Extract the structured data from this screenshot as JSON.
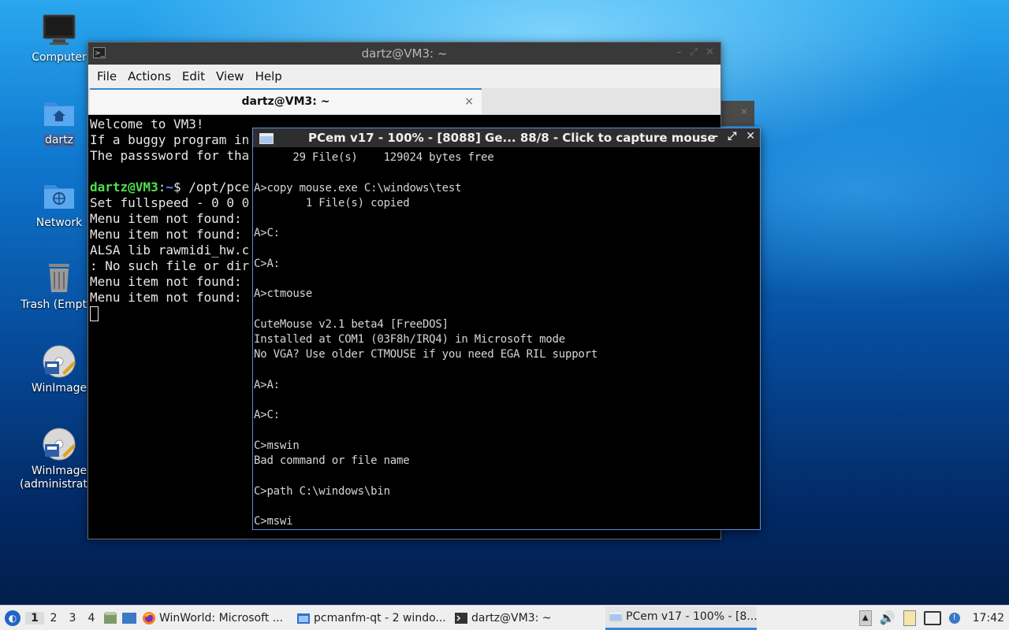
{
  "desktop": {
    "icons": [
      {
        "label": "Computer",
        "icon": "computer-icon"
      },
      {
        "label": "dartz",
        "icon": "home-folder-icon"
      },
      {
        "label": "Network",
        "icon": "network-folder-icon"
      },
      {
        "label": "Trash (Empty)",
        "icon": "trash-icon"
      },
      {
        "label": "WinImage",
        "icon": "winimage-icon"
      },
      {
        "label": "WinImage (administrator)",
        "icon": "winimage-admin-icon"
      }
    ]
  },
  "terminal": {
    "window_title": "dartz@VM3: ~",
    "menu": [
      "File",
      "Actions",
      "Edit",
      "View",
      "Help"
    ],
    "tab_label": "dartz@VM3: ~",
    "tab_close": "×",
    "lines": [
      "Welcome to VM3!",
      "If a buggy program in",
      "The passsword for tha",
      ""
    ],
    "prompt_user": "dartz@VM3",
    "prompt_sep": ":",
    "prompt_path": "~",
    "prompt_cmd": "$ /opt/pce",
    "output_lines": [
      "Set fullspeed - 0 0 0",
      "Menu item not found:",
      "Menu item not found:",
      "ALSA lib rawmidi_hw.c",
      ": No such file or dir",
      "Menu item not found:",
      "Menu item not found:"
    ]
  },
  "pcem": {
    "window_title": "PCem v17 - 100% - [8088] Ge... 88/8 - Click to capture mouse",
    "screen_lines": [
      "      29 File(s)    129024 bytes free",
      "",
      "A>copy mouse.exe C:\\windows\\test",
      "        1 File(s) copied",
      "",
      "A>C:",
      "",
      "C>A:",
      "",
      "A>ctmouse",
      "",
      "CuteMouse v2.1 beta4 [FreeDOS]",
      "Installed at COM1 (03F8h/IRQ4) in Microsoft mode",
      "No VGA? Use older CTMOUSE if you need EGA RIL support",
      "",
      "A>A:",
      "",
      "A>C:",
      "",
      "C>mswin",
      "Bad command or file name",
      "",
      "C>path C:\\windows\\bin",
      "",
      "C>mswi"
    ]
  },
  "taskbar": {
    "desktops": [
      "1",
      "2",
      "3",
      "4"
    ],
    "active_desktop": "1",
    "tasks": [
      {
        "label": "WinWorld: Microsoft ...",
        "icon": "firefox-icon"
      },
      {
        "label": "pcmanfm-qt - 2 windo...",
        "icon": "folder-icon"
      },
      {
        "label": "dartz@VM3: ~",
        "icon": "terminal-icon"
      },
      {
        "label": "PCem v17 - 100% - [8...",
        "icon": "pcem-icon"
      }
    ],
    "clock": "17:42"
  }
}
